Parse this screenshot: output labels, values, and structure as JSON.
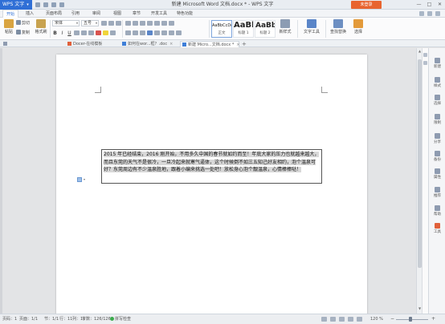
{
  "titlebar": {
    "app_label": "WPS 文字",
    "window_title": "新建 Microsoft Word 文档.docx * - WPS 文字",
    "login_label": "未登录",
    "controls": [
      "—",
      "□",
      "✕"
    ]
  },
  "ribbon_tabs": [
    "开始",
    "插入",
    "页面布局",
    "引用",
    "审阅",
    "视图",
    "章节",
    "开发工具",
    "特色功能"
  ],
  "toolbar": {
    "paste": "粘贴",
    "cut": "剪切",
    "copy": "复制",
    "format_painter": "格式刷",
    "font_name": "宋体",
    "font_size": "五号",
    "style_normal": "正文",
    "style_h1": "标题 1",
    "style_h2": "标题 2",
    "preview_normal": "AaBbCcDd",
    "preview_h1": "AaBb",
    "preview_h2": "AaBb",
    "new_style": "新样式",
    "text_tools": "文字工具",
    "find_replace": "查找替换",
    "select": "选择"
  },
  "doc_tabs": [
    {
      "label": "Docer-在线模板",
      "active": false
    },
    {
      "label": "如何在wor...框？.doc",
      "active": false
    },
    {
      "label": "新建 Micro...文档.docx *",
      "active": true
    }
  ],
  "document": {
    "paragraph": "2015 年已经结束，2016 刚开始，不用多久中国的春节就如约而至！年底大家的压力也就越来越大，而且东莞的天气不是很冷，一旦冷起来就寒气逼体，这个时候倒不如三五知己好友相约，泡个温泉可好？东莞周边有不少温泉胜地，跟着小编来挑选一处吧！放松身心泡个靓温泉，心情棒棒哒！"
  },
  "task_pane": [
    "新建",
    "样式",
    "选择",
    "限制",
    "分享",
    "备份",
    "属性",
    "推荐",
    "帮助",
    "工具"
  ],
  "statusbar": {
    "page_no": "页码：1",
    "pages": "页面：1/1",
    "section": "节：1/1",
    "row": "行：11",
    "col": "列：11",
    "word_count": "字数：126/126",
    "spell": "拼写检查",
    "zoom": "120 %"
  }
}
